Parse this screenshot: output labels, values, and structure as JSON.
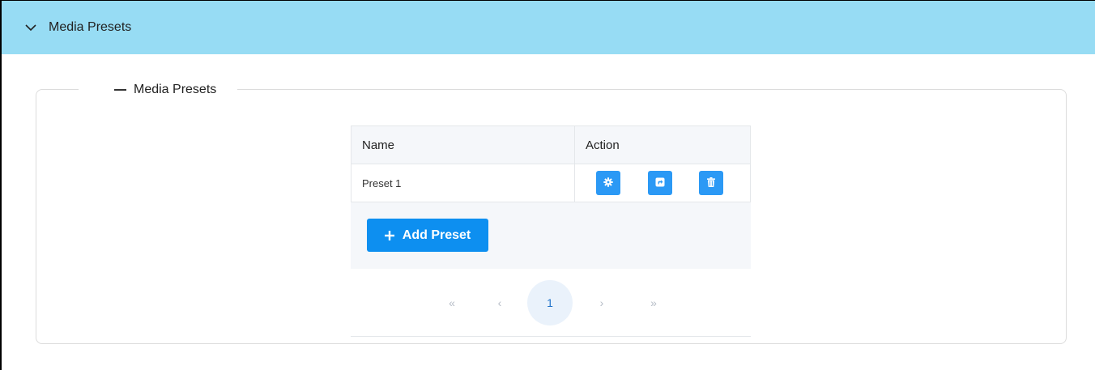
{
  "accordion": {
    "title": "Media Presets",
    "icon": "chevron-down-icon"
  },
  "section": {
    "legend": "Media Presets"
  },
  "table": {
    "columns": [
      "Name",
      "Action"
    ],
    "rows": [
      {
        "name": "Preset 1",
        "actions": [
          "gear-icon",
          "external-link-icon",
          "trash-icon"
        ]
      }
    ]
  },
  "add_button": {
    "icon": "plus-icon",
    "label": "Add Preset"
  },
  "pagination": {
    "first": "«",
    "prev": "‹",
    "current": "1",
    "next": "›",
    "last": "»"
  },
  "colors": {
    "header_bg": "#97dcf4",
    "primary": "#0d8ff0",
    "action_button": "#2b99f5"
  }
}
